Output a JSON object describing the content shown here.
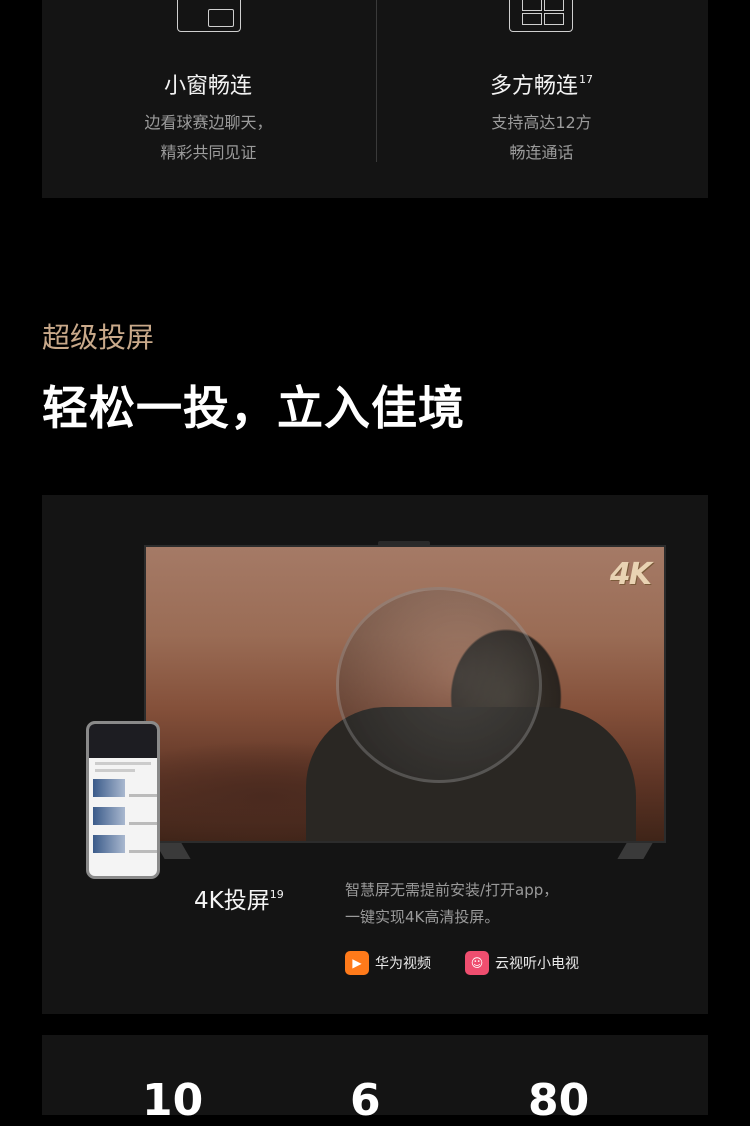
{
  "features": [
    {
      "title": "小窗畅连",
      "sup": "",
      "desc_lines": [
        "边看球赛边聊天，",
        "精彩共同见证"
      ],
      "icon": "picture-in-picture-icon"
    },
    {
      "title": "多方畅连",
      "sup": "17",
      "desc_lines": [
        "支持高达12方",
        "畅连通话"
      ],
      "icon": "grid-call-icon"
    }
  ],
  "section": {
    "tag": "超级投屏",
    "headline": "轻松一投，立入佳境"
  },
  "cast": {
    "badge": "4K",
    "title": "4K投屏",
    "title_sup": "19",
    "desc_lines": [
      "智慧屏无需提前安装/打开app，",
      "一键实现4K高清投屏。"
    ],
    "apps": [
      {
        "label": "华为视频",
        "icon": "huawei-video-icon",
        "color": "#ff7a1a"
      },
      {
        "label": "云视听小电视",
        "icon": "tv-app-icon",
        "color": "#ef4e6f"
      }
    ]
  },
  "stats": [
    "10",
    "6",
    "80"
  ]
}
